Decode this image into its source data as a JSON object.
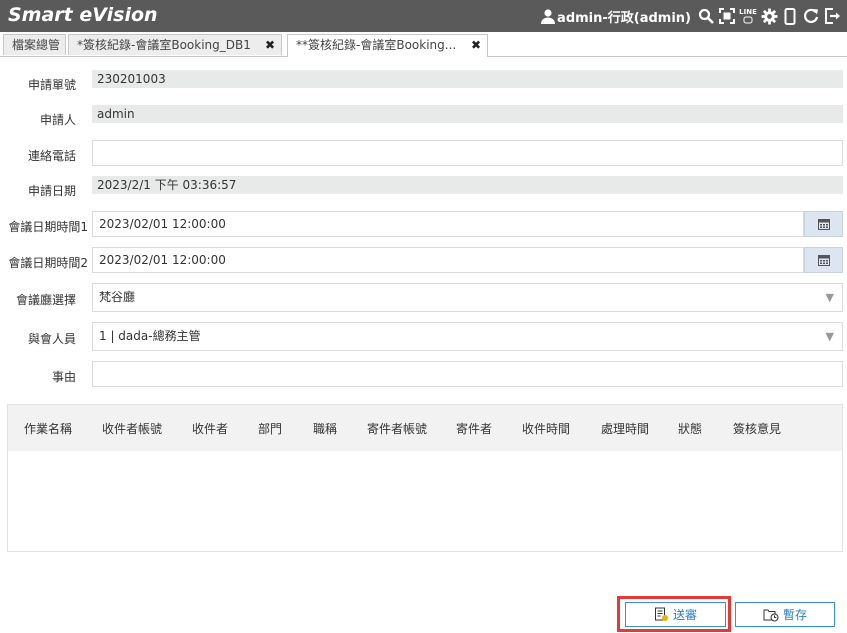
{
  "app": {
    "title": "Smart eVision",
    "user": "admin-行政(admin)"
  },
  "header_icons": [
    "user-icon",
    "search-icon",
    "fullscreen-icon",
    "line-icon",
    "gear-icon",
    "mobile-icon",
    "refresh-icon",
    "logout-icon"
  ],
  "line_icon_text": "LINE",
  "tabs": [
    {
      "label": "檔案總管"
    },
    {
      "label": "*簽核紀錄-會議室Booking_DB1"
    },
    {
      "label": "**簽核紀錄-會議室Booking..."
    }
  ],
  "form": {
    "apply_no_label": "申請單號",
    "apply_no": "230201003",
    "applicant_label": "申請人",
    "applicant": "admin",
    "phone_label": "連絡電話",
    "phone": "",
    "apply_date_label": "申請日期",
    "apply_date": "2023/2/1 下午 03:36:57",
    "datetime1_label": "會議日期時間1",
    "datetime1": "2023/02/01 12:00:00",
    "datetime2_label": "會議日期時間2",
    "datetime2": "2023/02/01 12:00:00",
    "room_label": "會議廳選擇",
    "room": "梵谷廳",
    "attendee_label": "與會人員",
    "attendee": "1 | dada-總務主管",
    "reason_label": "事由",
    "reason": ""
  },
  "grid": {
    "columns": [
      "作業名稱",
      "收件者帳號",
      "收件者",
      "部門",
      "職稱",
      "寄件者帳號",
      "寄件者",
      "收件時間",
      "處理時間",
      "狀態",
      "簽核意見"
    ]
  },
  "buttons": {
    "submit": "送審",
    "save": "暫存"
  },
  "colors": {
    "header_bg": "#5a5a5a",
    "accent": "#2d7fc7",
    "highlight": "#e53935"
  }
}
